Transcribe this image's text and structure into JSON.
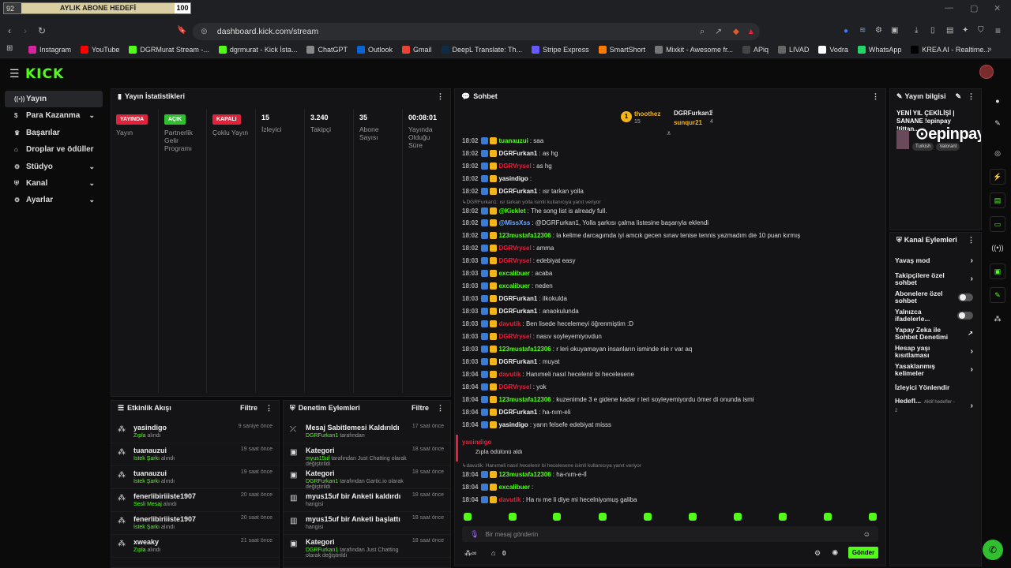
{
  "browser": {
    "goal_widget": {
      "current": "92",
      "label": "AYLIK ABONE HEDEFİ",
      "target": "100"
    },
    "url": "dashboard.kick.com/stream",
    "bookmarks": [
      "Instagram",
      "YouTube",
      "DGRMurat Stream -...",
      "dgrmurat - Kick İsta...",
      "ChatGPT",
      "Outlook",
      "Gmail",
      "DeepL Translate: Th...",
      "Stripe Express",
      "SmartShort",
      "Mixkit - Awesome fr...",
      "APiq",
      "LIVAD",
      "Vodra",
      "WhatsApp",
      "KREA AI - Realtime..."
    ]
  },
  "brand": {
    "logo": "KICK",
    "accent": "#53fc18"
  },
  "sidebar": {
    "items": [
      {
        "label": "Yayın",
        "icon": "broadcast-icon",
        "active": true,
        "chevron": false
      },
      {
        "label": "Para Kazanma",
        "icon": "dollar-icon",
        "active": false,
        "chevron": true
      },
      {
        "label": "Başarılar",
        "icon": "trophy-icon",
        "active": false,
        "chevron": false
      },
      {
        "label": "Droplar ve ödüller",
        "icon": "gift-icon",
        "active": false,
        "chevron": false
      },
      {
        "label": "Stüdyo",
        "icon": "studio-icon",
        "active": false,
        "chevron": true
      },
      {
        "label": "Kanal",
        "icon": "channel-icon",
        "active": false,
        "chevron": true
      },
      {
        "label": "Ayarlar",
        "icon": "gear-icon",
        "active": false,
        "chevron": true
      }
    ]
  },
  "stats": {
    "title": "Yayın İstatistikleri",
    "cells": [
      {
        "value": "YAYINDA",
        "label": "Yayın",
        "badge_color": "#e0223a"
      },
      {
        "value": "AÇIK",
        "label": "Partnerlik Gelir Programı",
        "badge_color": "#2fbf2f"
      },
      {
        "value": "KAPALI",
        "label": "Çoklu Yayın",
        "badge_color": "#e0223a"
      },
      {
        "value": "15",
        "label": "İzleyici"
      },
      {
        "value": "3.240",
        "label": "Takipçi"
      },
      {
        "value": "35",
        "label": "Abone Sayısı"
      },
      {
        "value": "00:08:01",
        "label": "Yayında Olduğu Süre"
      }
    ]
  },
  "activity": {
    "title": "Etkinlik Akışı",
    "filter": "Filtre",
    "items": [
      {
        "name": "yasindigo",
        "sub_hl": "Zıpla",
        "sub": "alındı",
        "time": "9 saniye önce"
      },
      {
        "name": "tuanauzui",
        "sub_hl": "İstek Şarkı",
        "sub": "alındı",
        "time": "19 saat önce"
      },
      {
        "name": "tuanauzui",
        "sub_hl": "İstek Şarkı",
        "sub": "alındı",
        "time": "19 saat önce"
      },
      {
        "name": "fenerlibiriiiste1907",
        "sub_hl": "Sesli Mesaj",
        "sub": "alındı",
        "time": "20 saat önce"
      },
      {
        "name": "fenerlibiriiiste1907",
        "sub_hl": "İstek Şarkı",
        "sub": "alındı",
        "time": "20 saat önce"
      },
      {
        "name": "xweaky",
        "sub_hl": "Zıpla",
        "sub": "alındı",
        "time": "21 saat önce"
      }
    ]
  },
  "moderation": {
    "title": "Denetim Eylemleri",
    "filter": "Filtre",
    "items": [
      {
        "name": "Mesaj Sabitlemesi Kaldırıldı",
        "sub_hl": "DGRFurkan1",
        "sub": "tarafından",
        "time": "17 saat önce",
        "icon": "unpin-icon"
      },
      {
        "name": "Kategori",
        "sub_hl": "myus15uf",
        "sub": "tarafından Just Chatting olarak değiştirildi",
        "time": "18 saat önce",
        "icon": "category-icon"
      },
      {
        "name": "Kategori",
        "sub_hl": "DGRFurkan1",
        "sub": "tarafından Gartic.io olarak değiştirildi",
        "time": "18 saat önce",
        "icon": "category-icon"
      },
      {
        "name": "myus15uf bir Anketi kaldırdı",
        "sub_hl": "",
        "sub": "hangisi",
        "time": "18 saat önce",
        "icon": "poll-icon"
      },
      {
        "name": "myus15uf bir Anketi başlattı",
        "sub_hl": "",
        "sub": "hangisi",
        "time": "18 saat önce",
        "icon": "poll-icon"
      },
      {
        "name": "Kategori",
        "sub_hl": "DGRFurkan1",
        "sub": "tarafından Just Chatting olarak değiştirildi",
        "time": "18 saat önce",
        "icon": "category-icon"
      }
    ]
  },
  "chat": {
    "title": "Sohbet",
    "top_users": [
      {
        "name": "thoothez",
        "count": "15"
      },
      {
        "name": "DGRFurkan1",
        "count": "4"
      },
      {
        "name": "sunqur21",
        "count": "4"
      }
    ],
    "messages": [
      {
        "time": "18:02",
        "user": "tuanauzui",
        "color": "#53fc18",
        "text": "saa"
      },
      {
        "time": "18:02",
        "user": "DGRFurkan1",
        "color": "#eeeeee",
        "text": "as hg"
      },
      {
        "time": "18:02",
        "user": "DGRVrysel",
        "color": "#e0223a",
        "text": "as hg"
      },
      {
        "time": "18:02",
        "user": "yasindigo",
        "color": "#eeeeee",
        "text": ""
      },
      {
        "time": "18:02",
        "user": "DGRFurkan1",
        "color": "#eeeeee",
        "text": "ısr tarkan yolla"
      },
      {
        "time": "18:02",
        "user": "@Kicklet",
        "color": "#53fc18",
        "text": "The song list is already full.",
        "reply": "DGRFurkan1: ısr tarkan yolla isimli kullanıcıya yanıt veriyor"
      },
      {
        "time": "18:02",
        "user": "@MissXss",
        "color": "#6fa8ff",
        "text": "@DGRFurkan1, Yolla şarkısı çalma listesine başarıyla eklendi"
      },
      {
        "time": "18:02",
        "user": "123mustafa12306",
        "color": "#53fc18",
        "text": "la kelime darcagımda iyi amcık gecen sınav tenise tennis yazmadım die 10 puan kırmış"
      },
      {
        "time": "18:02",
        "user": "DGRVrysel",
        "color": "#e0223a",
        "text": "amma"
      },
      {
        "time": "18:03",
        "user": "DGRVrysel",
        "color": "#e0223a",
        "text": "edebiyat easy"
      },
      {
        "time": "18:03",
        "user": "excalibuer",
        "color": "#53fc18",
        "text": "acaba"
      },
      {
        "time": "18:03",
        "user": "excalibuer",
        "color": "#53fc18",
        "text": "neden"
      },
      {
        "time": "18:03",
        "user": "DGRFurkan1",
        "color": "#eeeeee",
        "text": "ilkokulda"
      },
      {
        "time": "18:03",
        "user": "DGRFurkan1",
        "color": "#eeeeee",
        "text": "anaokulunda"
      },
      {
        "time": "18:03",
        "user": "davutik",
        "color": "#e0223a",
        "text": "Ben lisede hecelemeyi öğrenmiştim :D"
      },
      {
        "time": "18:03",
        "user": "DGRVrysel",
        "color": "#e0223a",
        "text": "nasıv soyleyemiyovdun"
      },
      {
        "time": "18:03",
        "user": "123mustafa12306",
        "color": "#53fc18",
        "text": "r leri okuyamayan insanların isminde nie r var aq"
      },
      {
        "time": "18:03",
        "user": "DGRFurkan1",
        "color": "#eeeeee",
        "text": "muyat"
      },
      {
        "time": "18:04",
        "user": "davutik",
        "color": "#e0223a",
        "text": "Hanımeli nasıl hecelenir bi hecelesene"
      },
      {
        "time": "18:04",
        "user": "DGRVrysel",
        "color": "#e0223a",
        "text": "yok"
      },
      {
        "time": "18:04",
        "user": "123mustafa12306",
        "color": "#53fc18",
        "text": "kuzenimde 3 e gidene kadar r leri soyleyemiyordu ömer di onunda ismi"
      },
      {
        "time": "18:04",
        "user": "DGRFurkan1",
        "color": "#eeeeee",
        "text": "ha-nım-eli"
      },
      {
        "time": "18:04",
        "user": "yasindigo",
        "color": "#eeeeee",
        "text": "yarın felsefe edebiyat misss"
      }
    ],
    "redeem": {
      "user": "yasindigo",
      "text": "Zıpla ödülünü aldı"
    },
    "after": [
      {
        "time": "18:04",
        "user": "123mustafa12306",
        "color": "#53fc18",
        "text": "ha-nım-e-lİ",
        "reply": "davutik: Hanımeli nasıl hecelenir bi hecelesene isimli kullanıcıya yanıt veriyor"
      },
      {
        "time": "18:04",
        "user": "excalibuer",
        "color": "#53fc18",
        "text": ""
      },
      {
        "time": "18:04",
        "user": "davutik",
        "color": "#e0223a",
        "text": "Ha nı me li diye mi hecelniyomuş galiba"
      }
    ],
    "input_placeholder": "Bir mesaj gönderin",
    "send": "Gönder",
    "points": "0"
  },
  "stream_info": {
    "title": "Yayın bilgisi",
    "stream_title": "YENİ YIL ÇEKİLİŞİ | SANANE !epinpay !tittan...",
    "tags": [
      "Turkish",
      "Valorant"
    ],
    "sponsor": "epinpay"
  },
  "channel_actions": {
    "title": "Kanal Eylemleri",
    "items": [
      {
        "label": "Yavaş mod",
        "type": "chevron"
      },
      {
        "label": "Takipçilere özel sohbet",
        "type": "chevron"
      },
      {
        "label": "Abonelere özel sohbet",
        "type": "toggle"
      },
      {
        "label": "Yalnızca ifadelerle...",
        "type": "toggle"
      },
      {
        "label": "Yapay Zeka ile Sohbet Denetimi",
        "type": "external"
      },
      {
        "label": "Hesap yaşı kısıtlaması",
        "type": "chevron"
      },
      {
        "label": "Yasaklanmış kelimeler",
        "type": "chevron"
      },
      {
        "label": "İzleyici Yönlendir",
        "type": "none"
      },
      {
        "label": "Hedefl...",
        "type": "chevron",
        "extra": "Aktif hedefler - 2"
      }
    ]
  }
}
